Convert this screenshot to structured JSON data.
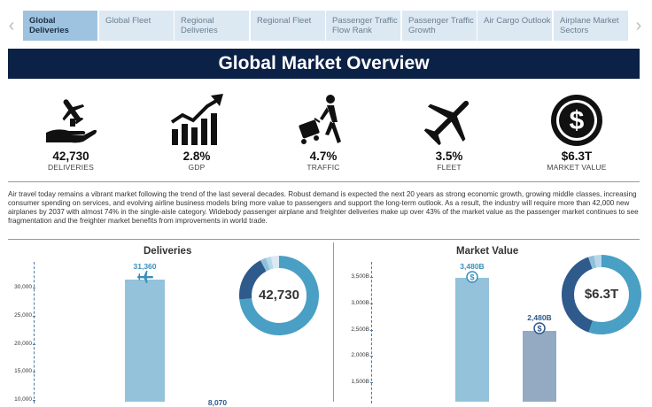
{
  "tabs": [
    {
      "label": "Global Deliveries",
      "active": true
    },
    {
      "label": "Global Fleet"
    },
    {
      "label": "Regional Deliveries"
    },
    {
      "label": "Regional Fleet"
    },
    {
      "label": "Passenger Traffic Flow Rank"
    },
    {
      "label": "Passenger Traffic Growth"
    },
    {
      "label": "Air Cargo Outlook"
    },
    {
      "label": "Airplane Market Sectors"
    }
  ],
  "page_title": "Global Market Overview",
  "kpis": [
    {
      "value": "42,730",
      "label": "DELIVERIES",
      "icon": "hand-plane-icon"
    },
    {
      "value": "2.8%",
      "label": "GDP",
      "icon": "growth-chart-icon"
    },
    {
      "value": "4.7%",
      "label": "TRAFFIC",
      "icon": "traveler-icon"
    },
    {
      "value": "3.5%",
      "label": "FLEET",
      "icon": "airplane-icon"
    },
    {
      "value": "$6.3T",
      "label": "MARKET VALUE",
      "icon": "dollar-coin-icon"
    }
  ],
  "description": "Air travel today remains a vibrant market following the trend of the last several decades. Robust demand is expected the next 20 years as strong economic growth, growing middle classes, increasing consumer spending on services, and evolving airline business models bring more value to passengers and support the long-term outlook.  As a result, the industry will require more than 42,000 new airplanes by 2037 with almost 74% in the single-aisle category. Widebody passenger airplane and freighter deliveries make up over 43% of the market value as the passenger market continues to see fragmentation and the freighter market benefits from improvements in world trade.",
  "colors": {
    "accent_light": "#8fc0da",
    "accent_dark": "#2e5a8c",
    "bar_grey": "#94a9c2",
    "banner": "#0c2146",
    "label_blue": "#3a8fb7"
  },
  "chart_data": [
    {
      "type": "bar",
      "title": "Deliveries",
      "y_ticks": [
        "10,000",
        "15,000",
        "20,000",
        "25,000",
        "30,000"
      ],
      "ylim": [
        10000,
        35000
      ],
      "values": [
        31360,
        8070
      ],
      "value_labels": [
        "31,360",
        "8,070"
      ],
      "donut": {
        "center_label": "42,730",
        "slices": [
          31360,
          8070,
          1000,
          900,
          1400
        ],
        "slice_colors": [
          "#4a9fc4",
          "#2e5a8c",
          "#8fc0da",
          "#b6d8ea",
          "#dce8f2"
        ]
      }
    },
    {
      "type": "bar",
      "title": "Market Value",
      "y_ticks": [
        "1,500B",
        "2,000B",
        "2,500B",
        "3,000B",
        "3,500B"
      ],
      "ylim": [
        1000,
        3800
      ],
      "values": [
        3480,
        2480
      ],
      "value_labels": [
        "3,480B",
        "2,480B"
      ],
      "donut": {
        "center_label": "$6.3T",
        "slices": [
          3480,
          2480,
          150,
          190
        ],
        "slice_colors": [
          "#4a9fc4",
          "#2e5a8c",
          "#8fc0da",
          "#b6d8ea"
        ]
      }
    }
  ]
}
